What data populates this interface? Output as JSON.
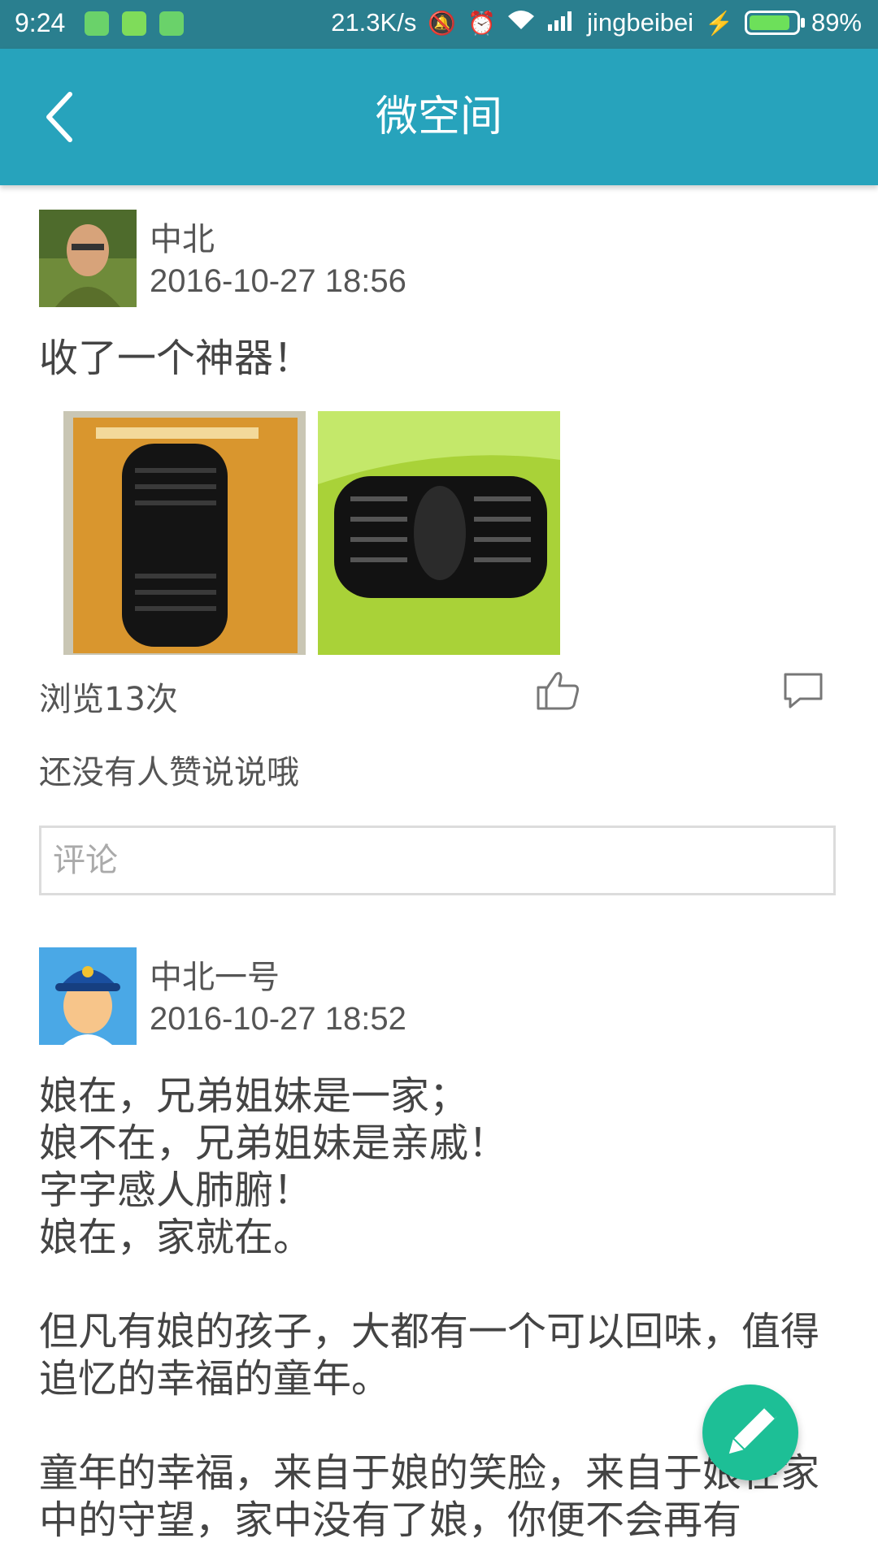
{
  "status_bar": {
    "time": "9:24",
    "net_speed": "21.3K/s",
    "carrier": "jingbeibei",
    "battery_pct": "89%",
    "battery_level": 0.89
  },
  "app_bar": {
    "title": "微空间"
  },
  "posts": [
    {
      "user": "中北",
      "time": "2016-10-27 18:56",
      "text": "收了一个神器！",
      "photos": [
        "keyboard-package-photo",
        "keyboard-on-green-photo"
      ],
      "views": "浏览13次",
      "likes_text": "还没有人赞说说哦",
      "comment_placeholder": "评论"
    },
    {
      "user": "中北一号",
      "time": "2016-10-27 18:52",
      "text": "娘在，兄弟姐妹是一家；\n娘不在，兄弟姐妹是亲戚！\n字字感人肺腑！\n娘在，家就在。\n\n但凡有娘的孩子，大都有一个可以回味，值得追忆的幸福的童年。\n\n童年的幸福，来自于娘的笑脸，来自于娘在家中的守望，家中没有了娘，你便不会再有"
    }
  ],
  "colors": {
    "app_bar": "#27a3bc",
    "status_bar": "#2a7f8f",
    "fab": "#1dbf96"
  },
  "icons": {
    "back": "chevron-left-icon",
    "like": "thumbs-up-icon",
    "comment": "comment-bubble-icon",
    "fab": "pencil-icon"
  }
}
